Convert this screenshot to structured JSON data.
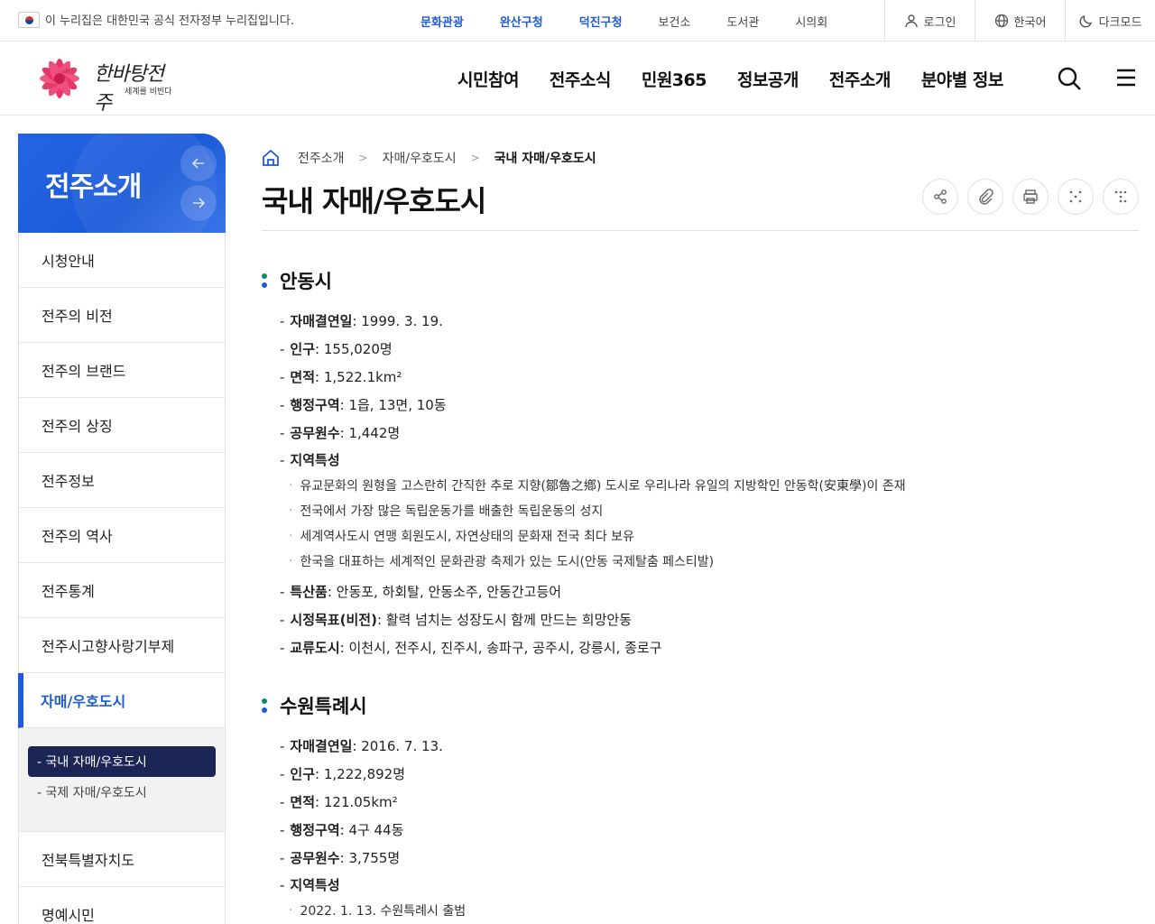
{
  "gov_notice": "이 누리집은 대한민국 공식 전자정부 누리집입니다.",
  "quick_links": [
    {
      "label": "문화관광",
      "highlight": true
    },
    {
      "label": "완산구청",
      "highlight": true
    },
    {
      "label": "덕진구청",
      "highlight": true
    },
    {
      "label": "보건소",
      "highlight": false
    },
    {
      "label": "도서관",
      "highlight": false
    },
    {
      "label": "시의회",
      "highlight": false
    }
  ],
  "utility": {
    "login": "로그인",
    "language": "한국어",
    "dark_mode": "다크모드"
  },
  "logo": {
    "text": "한바탕전주",
    "sub": "세계를 비빈다"
  },
  "gnb": [
    "시민참여",
    "전주소식",
    "민원365",
    "정보공개",
    "전주소개",
    "분야별 정보"
  ],
  "lnb": {
    "title": "전주소개",
    "items": [
      "시청안내",
      "전주의 비전",
      "전주의 브랜드",
      "전주의 상징",
      "전주정보",
      "전주의 역사",
      "전주통계",
      "전주시고향사랑기부제",
      "자매/우호도시"
    ],
    "active_index": 8,
    "sub_items": [
      "- 국내 자매/우호도시",
      "- 국제 자매/우호도시"
    ],
    "after_items": [
      "전북특별자치도",
      "명예시민"
    ]
  },
  "breadcrumb": [
    "전주소개",
    "자매/우호도시",
    "국내 자매/우호도시"
  ],
  "page_title": "국내 자매/우호도시",
  "colors": {
    "primary": "#1f5bd6",
    "navy": "#1b2556",
    "green": "#0e8a6a"
  },
  "sections": [
    {
      "title": "안동시",
      "rows_before": [
        {
          "label": "자매결연일",
          "value": " : 1999. 3. 19."
        },
        {
          "label": "인구",
          "value": " : 155,020명"
        },
        {
          "label": "면적",
          "value": " : 1,522.1km²"
        },
        {
          "label": "행정구역",
          "value": " : 1읍, 13면, 10동"
        },
        {
          "label": "공무원수",
          "value": " : 1,442명"
        }
      ],
      "features_label": "지역특성",
      "features": [
        "유교문화의 원형을 고스란히 간직한 추로 지향(鄒魯之鄕) 도시로 우리나라 유일의 지방학인 안동학(安東學)이 존재",
        "전국에서 가장 많은 독립운동가를 배출한 독립운동의 성지",
        "세계역사도시 연맹 회원도시, 자연상태의 문화재 전국 최다 보유",
        "한국을 대표하는 세계적인 문화관광 축제가 있는 도시(안동 국제탈춤 페스티발)"
      ],
      "rows_after": [
        {
          "label": "특산품",
          "value": " : 안동포, 하회탈, 안동소주, 안동간고등어"
        },
        {
          "label": "시정목표(비전)",
          "value": " : 활력 넘치는 성장도시 함께 만드는 희망안동"
        },
        {
          "label": "교류도시",
          "value": " : 이천시, 전주시, 진주시, 송파구, 공주시, 강릉시, 종로구"
        }
      ]
    },
    {
      "title": "수원특례시",
      "rows_before": [
        {
          "label": "자매결연일",
          "value": " : 2016. 7. 13."
        },
        {
          "label": "인구",
          "value": " : 1,222,892명"
        },
        {
          "label": "면적",
          "value": " : 121.05km²"
        },
        {
          "label": "행정구역",
          "value": " : 4구 44동"
        },
        {
          "label": "공무원수",
          "value": " : 3,755명"
        }
      ],
      "features_label": "지역특성",
      "features": [
        "2022. 1. 13. 수원특례시 출범"
      ],
      "rows_after": []
    }
  ]
}
